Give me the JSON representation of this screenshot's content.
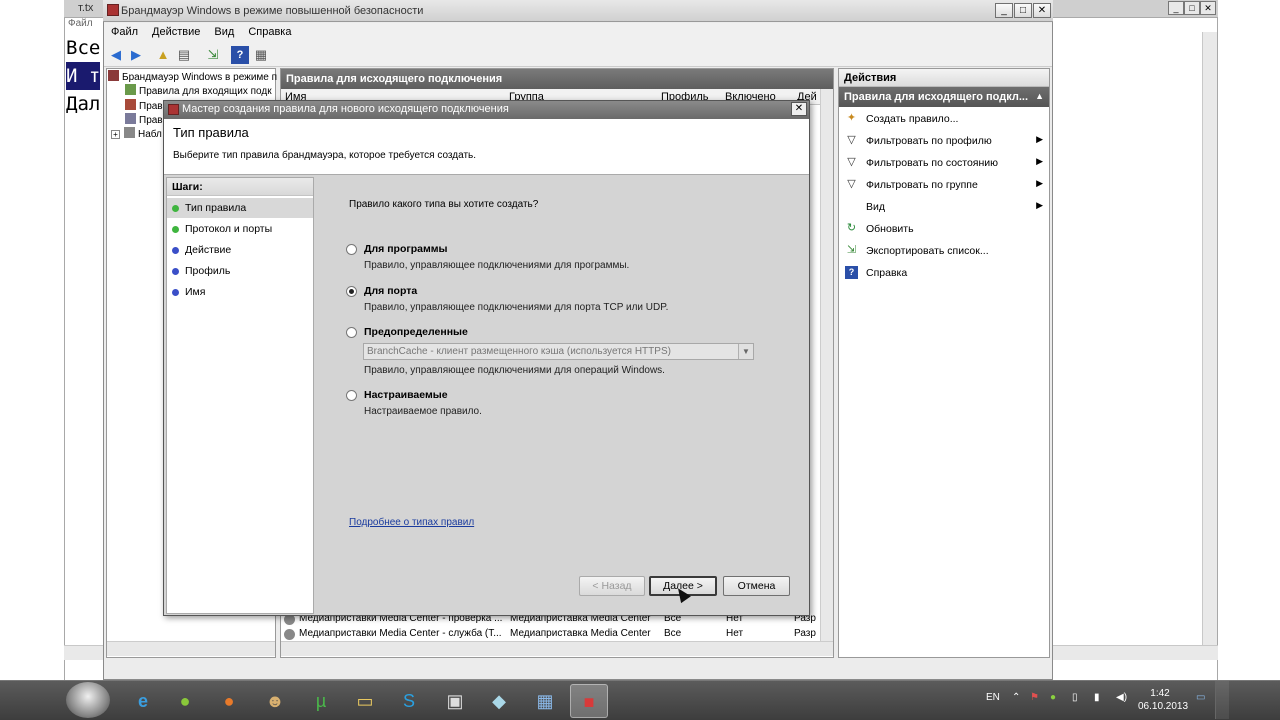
{
  "bg_notepad": {
    "title": "т.tx",
    "menu": "Файл",
    "lines": [
      "Все",
      "И т",
      "Дал"
    ]
  },
  "main_window": {
    "title": "Брандмауэр Windows в режиме повышенной безопасности",
    "menu": [
      "Файл",
      "Действие",
      "Вид",
      "Справка"
    ],
    "tree": [
      "Брандмауэр Windows в режиме п",
      "Правила для входящих подк",
      "Прав",
      "Прав",
      "Набл"
    ],
    "center_header": "Правила для исходящего подключения",
    "columns": [
      "Имя",
      "Группа",
      "Профиль",
      "Включено",
      "Дей"
    ],
    "rows": [
      {
        "name": "Медиаприставки Media Center - проверка ...",
        "group": "Медиаприставка Media Center",
        "profile": "Все",
        "enabled": "Нет",
        "action": "Разр"
      },
      {
        "name": "Медиаприставки Media Center - служба (Т...",
        "group": "Медиаприставка Media Center",
        "profile": "Все",
        "enabled": "Нет",
        "action": "Разр"
      }
    ],
    "actions_header": "Действия",
    "actions_sub": "Правила для исходящего подкл...",
    "actions": [
      {
        "label": "Создать правило...",
        "icon": "new-rule-icon"
      },
      {
        "label": "Фильтровать по профилю",
        "icon": "filter-icon",
        "arrow": "▶"
      },
      {
        "label": "Фильтровать по состоянию",
        "icon": "filter-icon",
        "arrow": "▶"
      },
      {
        "label": "Фильтровать по группе",
        "icon": "filter-icon",
        "arrow": "▶"
      },
      {
        "label": "Вид",
        "icon": "",
        "arrow": "▶"
      },
      {
        "label": "Обновить",
        "icon": "refresh-icon"
      },
      {
        "label": "Экспортировать список...",
        "icon": "export-icon"
      },
      {
        "label": "Справка",
        "icon": "help-icon"
      }
    ]
  },
  "wizard": {
    "title": "Мастер создания правила для нового исходящего подключения",
    "heading": "Тип правила",
    "subheading": "Выберите тип правила брандмауэра, которое требуется создать.",
    "steps_header": "Шаги:",
    "steps": [
      {
        "label": "Тип правила",
        "current": true,
        "color": "#3fb53f"
      },
      {
        "label": "Протокол и порты",
        "current": false,
        "color": "#3fb53f"
      },
      {
        "label": "Действие",
        "current": false,
        "color": "#3a4fc8"
      },
      {
        "label": "Профиль",
        "current": false,
        "color": "#3a4fc8"
      },
      {
        "label": "Имя",
        "current": false,
        "color": "#3a4fc8"
      }
    ],
    "question": "Правило какого типа вы хотите создать?",
    "options": [
      {
        "label": "Для программы",
        "desc": "Правило, управляющее подключениями для программы.",
        "selected": false
      },
      {
        "label": "Для порта",
        "desc": "Правило, управляющее подключениями для порта TCP или UDP.",
        "selected": true
      },
      {
        "label": "Предопределенные",
        "desc": "Правило, управляющее подключениями для операций Windows.",
        "selected": false
      },
      {
        "label": "Настраиваемые",
        "desc": "Настраиваемое правило.",
        "selected": false
      }
    ],
    "predefined_select": "BranchCache - клиент размещенного кэша (используется HTTPS)",
    "link": "Подробнее о типах правил",
    "buttons": {
      "back": "< Назад",
      "next": "Далее >",
      "cancel": "Отмена"
    }
  },
  "taskbar": {
    "lang": "EN",
    "time": "1:42",
    "date": "06.10.2013"
  }
}
